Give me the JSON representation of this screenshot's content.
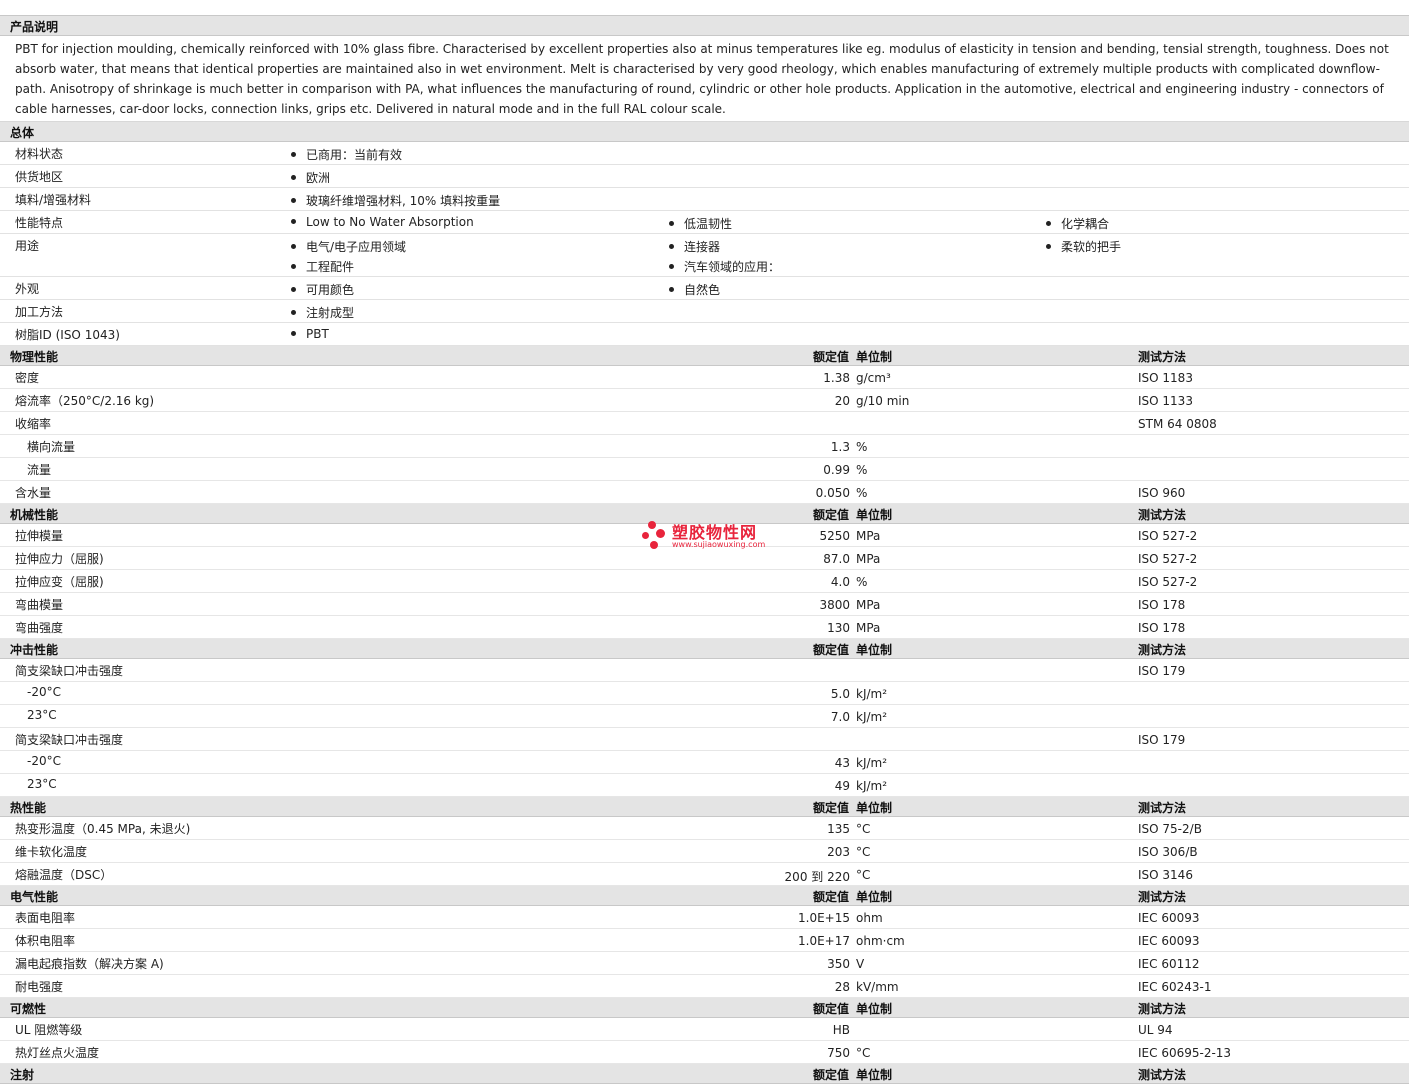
{
  "desc_section": {
    "title": "产品说明",
    "text": "PBT for injection moulding, chemically reinforced with 10% glass fibre. Characterised by excellent properties also at minus temperatures like eg. modulus of elasticity in tension and bending, tensial strength, toughness. Does not absorb water, that means that identical properties are maintained also in wet environment. Melt is characterised by very good rheology, which enables manufacturing of extremely multiple products with complicated downflow-path. Anisotropy of shrinkage is much better in comparison with PA, what influences the manufacturing of round, cylindric or other hole products. Application in the automotive, electrical and engineering industry - connectors of cable harnesses, car-door locks, connection links, grips etc. Delivered in natural mode and in the full RAL colour scale."
  },
  "general": {
    "title": "总体",
    "rows": [
      {
        "label": "材料状态",
        "items": [
          "已商用：当前有效"
        ]
      },
      {
        "label": "供货地区",
        "items": [
          "欧洲"
        ]
      },
      {
        "label": "填料/增强材料",
        "items": [
          "玻璃纤维增强材料, 10% 填料按重量"
        ]
      },
      {
        "label": "性能特点",
        "items": [
          "Low to No Water Absorption",
          "低温韧性",
          "化学耦合"
        ]
      },
      {
        "label": "用途",
        "items": [
          "电气/电子应用领域",
          "连接器",
          "柔软的把手",
          "工程配件",
          "汽车领域的应用："
        ]
      },
      {
        "label": "外观",
        "items": [
          "可用颜色",
          "自然色"
        ]
      },
      {
        "label": "加工方法",
        "items": [
          "注射成型"
        ]
      },
      {
        "label": "树脂ID (ISO 1043)",
        "items": [
          "PBT"
        ]
      }
    ]
  },
  "headers": {
    "value": "额定值",
    "unit": "单位制",
    "method": "测试方法"
  },
  "sections": [
    {
      "title": "物理性能",
      "rows": [
        {
          "label": "密度",
          "value": "1.38",
          "unit": "g/cm³",
          "method": "ISO 1183"
        },
        {
          "label": "熔流率（250°C/2.16 kg)",
          "value": "20",
          "unit": "g/10 min",
          "method": "ISO 1133"
        },
        {
          "label": "收缩率",
          "value": "",
          "unit": "",
          "method": "STM 64 0808"
        },
        {
          "label": "横向流量",
          "value": "1.3",
          "unit": "%",
          "method": "",
          "sub": true
        },
        {
          "label": "流量",
          "value": "0.99",
          "unit": "%",
          "method": "",
          "sub": true
        },
        {
          "label": "含水量",
          "value": "0.050",
          "unit": "%",
          "method": "ISO 960"
        }
      ]
    },
    {
      "title": "机械性能",
      "rows": [
        {
          "label": "拉伸模量",
          "value": "5250",
          "unit": "MPa",
          "method": "ISO 527-2"
        },
        {
          "label": "拉伸应力（屈服)",
          "value": "87.0",
          "unit": "MPa",
          "method": "ISO 527-2"
        },
        {
          "label": "拉伸应变（屈服)",
          "value": "4.0",
          "unit": "%",
          "method": "ISO 527-2"
        },
        {
          "label": "弯曲模量",
          "value": "3800",
          "unit": "MPa",
          "method": "ISO 178"
        },
        {
          "label": "弯曲强度",
          "value": "130",
          "unit": "MPa",
          "method": "ISO 178"
        }
      ]
    },
    {
      "title": "冲击性能",
      "rows": [
        {
          "label": "简支梁缺口冲击强度",
          "value": "",
          "unit": "",
          "method": "ISO 179"
        },
        {
          "label": "-20°C",
          "value": "5.0",
          "unit": "kJ/m²",
          "method": "",
          "sub": true
        },
        {
          "label": "23°C",
          "value": "7.0",
          "unit": "kJ/m²",
          "method": "",
          "sub": true
        },
        {
          "label": "简支梁缺口冲击强度",
          "value": "",
          "unit": "",
          "method": "ISO 179"
        },
        {
          "label": "-20°C",
          "value": "43",
          "unit": "kJ/m²",
          "method": "",
          "sub": true
        },
        {
          "label": "23°C",
          "value": "49",
          "unit": "kJ/m²",
          "method": "",
          "sub": true
        }
      ]
    },
    {
      "title": "热性能",
      "rows": [
        {
          "label": "热变形温度（0.45 MPa, 未退火)",
          "value": "135",
          "unit": "°C",
          "method": "ISO 75-2/B"
        },
        {
          "label": "维卡软化温度",
          "value": "203",
          "unit": "°C",
          "method": "ISO 306/B"
        },
        {
          "label": "熔融温度（DSC）",
          "value": "200 到  220",
          "unit": "°C",
          "method": "ISO 3146"
        }
      ]
    },
    {
      "title": "电气性能",
      "rows": [
        {
          "label": "表面电阻率",
          "value": "1.0E+15",
          "unit": "ohm",
          "method": "IEC 60093"
        },
        {
          "label": "体积电阻率",
          "value": "1.0E+17",
          "unit": "ohm·cm",
          "method": "IEC 60093"
        },
        {
          "label": "漏电起痕指数（解决方案 A)",
          "value": "350",
          "unit": "V",
          "method": "IEC 60112"
        },
        {
          "label": "耐电强度",
          "value": "28",
          "unit": "kV/mm",
          "method": "IEC 60243-1"
        }
      ]
    },
    {
      "title": "可燃性",
      "rows": [
        {
          "label": "UL 阻燃等级",
          "value": "HB",
          "unit": "",
          "method": "UL 94"
        },
        {
          "label": "热灯丝点火温度",
          "value": "750",
          "unit": "°C",
          "method": "IEC 60695-2-13"
        }
      ]
    },
    {
      "title": "注射",
      "rows": []
    }
  ],
  "watermark": {
    "text": "塑胶物性网",
    "url": "www.sujiaowuxing.com"
  }
}
